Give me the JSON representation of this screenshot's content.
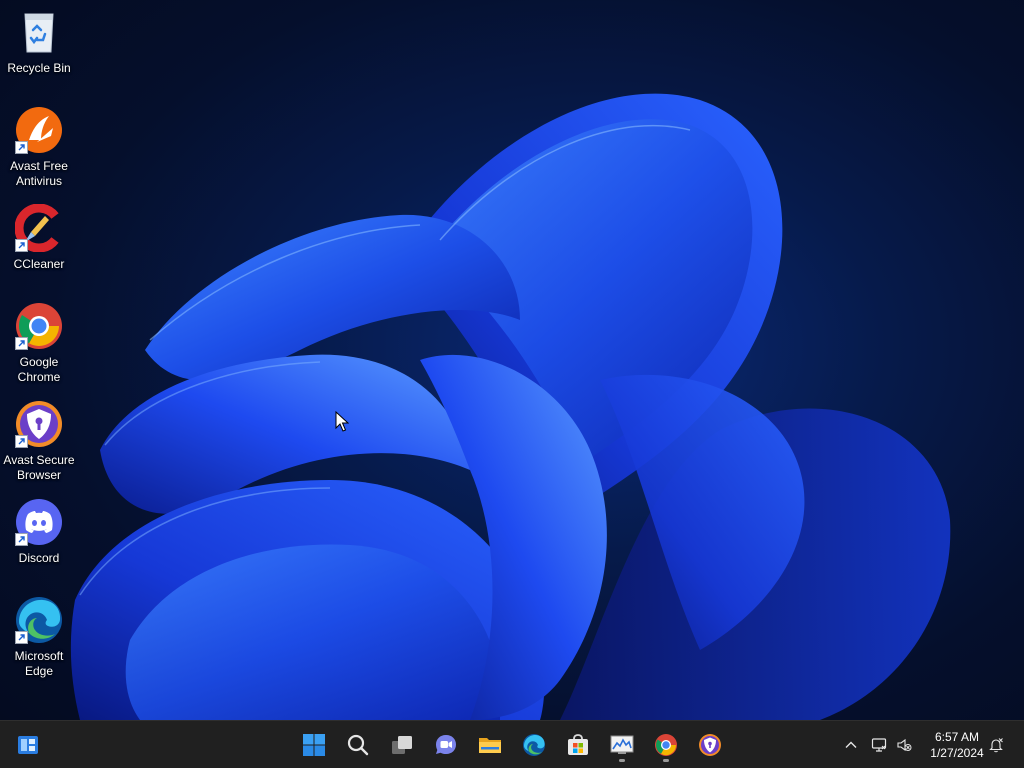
{
  "desktop": {
    "icons": [
      {
        "label": "Recycle Bin",
        "icon": "recycle-bin-icon",
        "shortcut": false
      },
      {
        "label": "Avast Free\nAntivirus",
        "icon": "avast-antivirus-icon",
        "shortcut": true
      },
      {
        "label": "CCleaner",
        "icon": "ccleaner-icon",
        "shortcut": true
      },
      {
        "label": "Google\nChrome",
        "icon": "chrome-icon",
        "shortcut": true
      },
      {
        "label": "Avast Secure\nBrowser",
        "icon": "avast-browser-icon",
        "shortcut": true
      },
      {
        "label": "Discord",
        "icon": "discord-icon",
        "shortcut": true
      },
      {
        "label": "Microsoft\nEdge",
        "icon": "edge-icon",
        "shortcut": true
      }
    ]
  },
  "taskbar": {
    "left": [
      {
        "icon": "widgets-icon"
      }
    ],
    "apps": [
      {
        "icon": "start-icon",
        "running": false
      },
      {
        "icon": "search-icon",
        "running": false
      },
      {
        "icon": "task-view-icon",
        "running": false
      },
      {
        "icon": "teams-chat-icon",
        "running": false
      },
      {
        "icon": "file-explorer-icon",
        "running": false
      },
      {
        "icon": "edge-icon",
        "running": false
      },
      {
        "icon": "microsoft-store-icon",
        "running": false
      },
      {
        "icon": "performance-monitor-icon",
        "running": true
      },
      {
        "icon": "chrome-icon",
        "running": true
      },
      {
        "icon": "avast-browser-icon",
        "running": false
      }
    ],
    "tray": [
      {
        "icon": "chevron-up-icon"
      },
      {
        "icon": "network-icon"
      },
      {
        "icon": "volume-muted-icon"
      }
    ],
    "clock": {
      "time": "6:57 AM",
      "date": "1/27/2024"
    },
    "notification_icon": "notification-icon"
  },
  "colors": {
    "taskbar": "#202020",
    "wallpaper_blue": "#1f4ff0",
    "wallpaper_dark": "#050f2c"
  }
}
